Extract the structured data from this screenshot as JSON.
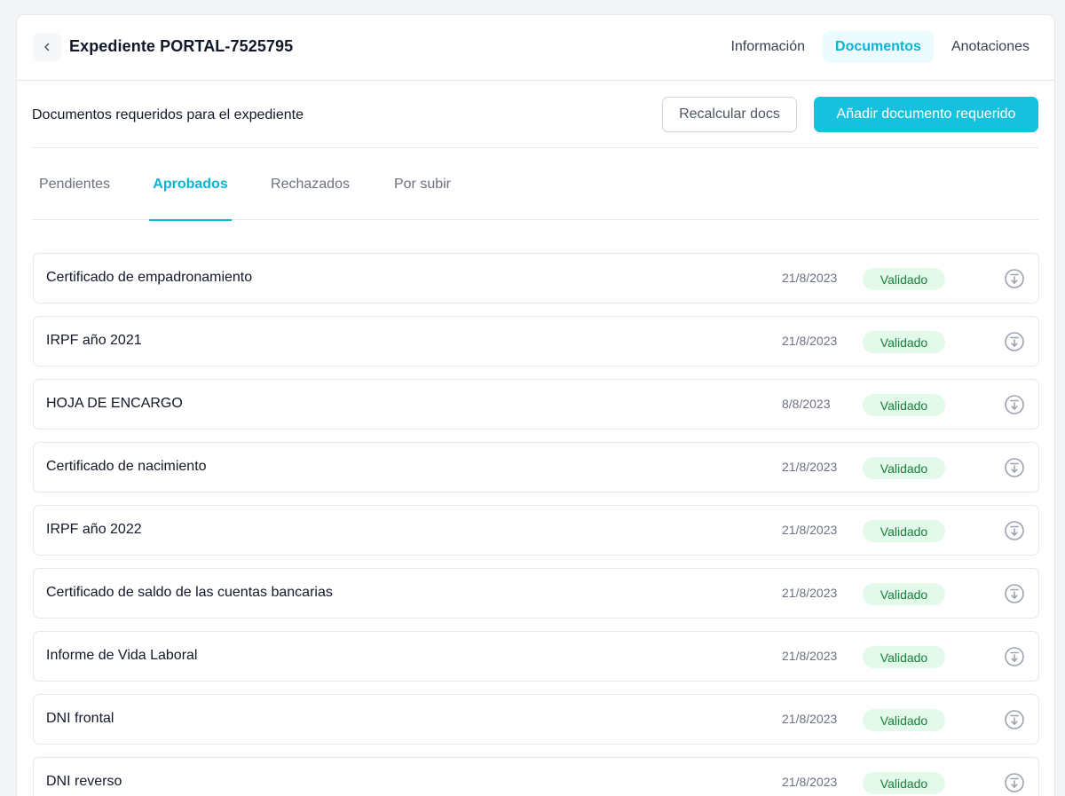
{
  "header": {
    "title": "Expediente PORTAL-7525795",
    "back_icon": "chevron-left-icon",
    "tabs": [
      {
        "label": "Información",
        "active": false
      },
      {
        "label": "Documentos",
        "active": true
      },
      {
        "label": "Anotaciones",
        "active": false
      }
    ]
  },
  "section": {
    "title": "Documentos requeridos para el expediente",
    "recalc_label": "Recalcular docs",
    "add_label": "Añadir documento requerido"
  },
  "subtabs": [
    {
      "label": "Pendientes",
      "active": false
    },
    {
      "label": "Aprobados",
      "active": true
    },
    {
      "label": "Rechazados",
      "active": false
    },
    {
      "label": "Por subir",
      "active": false
    }
  ],
  "documents": [
    {
      "name": "Certificado de empadronamiento",
      "date": "21/8/2023",
      "status": "Validado"
    },
    {
      "name": "IRPF año 2021",
      "date": "21/8/2023",
      "status": "Validado"
    },
    {
      "name": "HOJA DE ENCARGO",
      "date": "8/8/2023",
      "status": "Validado"
    },
    {
      "name": "Certificado de nacimiento",
      "date": "21/8/2023",
      "status": "Validado"
    },
    {
      "name": "IRPF año 2022",
      "date": "21/8/2023",
      "status": "Validado"
    },
    {
      "name": "Certificado de saldo de las cuentas bancarias",
      "date": "21/8/2023",
      "status": "Validado"
    },
    {
      "name": "Informe de Vida Laboral",
      "date": "21/8/2023",
      "status": "Validado"
    },
    {
      "name": "DNI frontal",
      "date": "21/8/2023",
      "status": "Validado"
    },
    {
      "name": "DNI reverso",
      "date": "21/8/2023",
      "status": "Validado"
    }
  ],
  "icons": {
    "download": "download-circle-icon"
  },
  "colors": {
    "accent": "#06b6d4",
    "primary_button": "#16c1dd",
    "badge_bg": "#e3f9ea",
    "badge_text": "#15803d"
  }
}
